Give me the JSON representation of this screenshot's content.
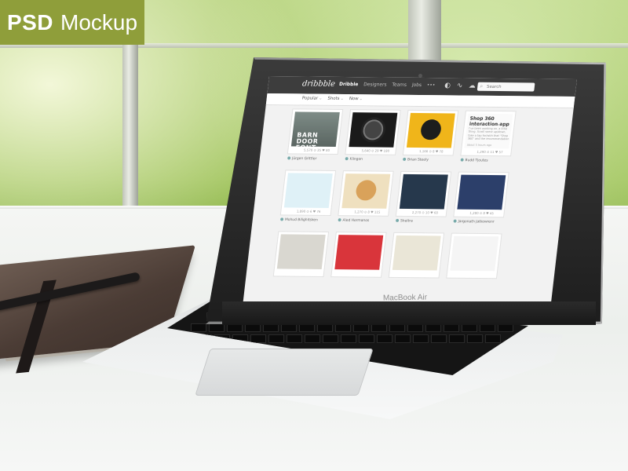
{
  "badge": {
    "bold": "PSD",
    "light": "Mockup"
  },
  "laptop": {
    "model": "MacBook Air"
  },
  "site": {
    "logo": "dribbble",
    "nav": [
      {
        "label": "Dribble",
        "active": true
      },
      {
        "label": "Designers",
        "active": false
      },
      {
        "label": "Teams",
        "active": false
      },
      {
        "label": "Jobs",
        "active": false
      }
    ],
    "nav_more": "•••",
    "search_placeholder": "Search",
    "filters": [
      "Popular",
      "Shots",
      "Now"
    ]
  },
  "shots": [
    {
      "stats": "5,570  ⊙ 35  ♥ 80",
      "author": "Jürgen Grittler",
      "barn_text": "BARN DOOR FONT"
    },
    {
      "stats": "5,640  ⊙ 29  ♥ 180",
      "author": "Klingon"
    },
    {
      "stats": "1,166  ⊙ 8  ♥ 78",
      "author": "Brian Steely"
    },
    {
      "title": "Shop 360 interaction app",
      "body": "Hi guys, there is something I've been working on. a little thing. Scroll some up/down, take a tap for/with that \"Shop 360\" and the recommendation",
      "foot": "about 5 hours ago",
      "stats": "1,290  ⊙ 11  ♥ 57",
      "author": "Budd Tjoutes"
    },
    {
      "stats": "1,890  ⊙ 6  ♥ 76",
      "author": "Mohud Bilighitsken"
    },
    {
      "stats": "1,270  ⊙ 8  ♥ 115",
      "author": "Aled Hermanos"
    },
    {
      "stats": "2,270  ⊙ 10  ♥ 68",
      "author": "Sheltra"
    },
    {
      "stats": "1,280  ⊙ 8  ♥ 45",
      "author": "Jargonath Jatkowrenr"
    },
    {
      "stats": "",
      "author": ""
    },
    {
      "stats": "",
      "author": ""
    },
    {
      "stats": "",
      "author": ""
    },
    {
      "stats": "",
      "author": ""
    }
  ]
}
